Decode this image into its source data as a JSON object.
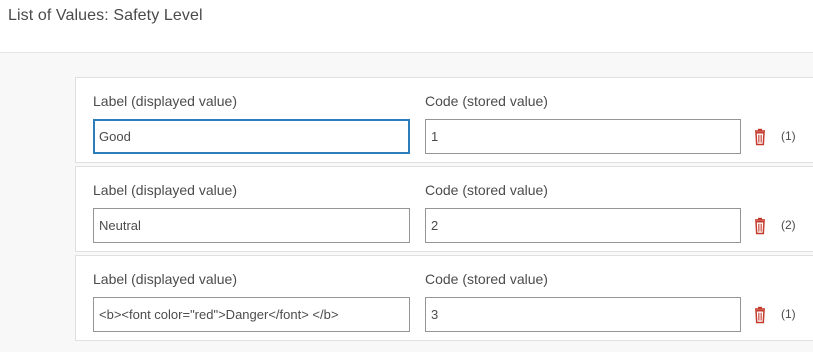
{
  "header": {
    "title": "List of Values: Safety Level"
  },
  "columns": {
    "label_heading": "Label (displayed value)",
    "code_heading": "Code (stored value)"
  },
  "rows": [
    {
      "label": "Good",
      "code": "1",
      "count": "(1)"
    },
    {
      "label": "Neutral",
      "code": "2",
      "count": "(2)"
    },
    {
      "label": "<b><font color=\"red\">Danger</font> </b>",
      "code": "3",
      "count": "(1)"
    }
  ],
  "colors": {
    "accent": "#2b7dbc",
    "delete": "#c43a2d"
  },
  "icons": {
    "delete": "trash-icon"
  }
}
